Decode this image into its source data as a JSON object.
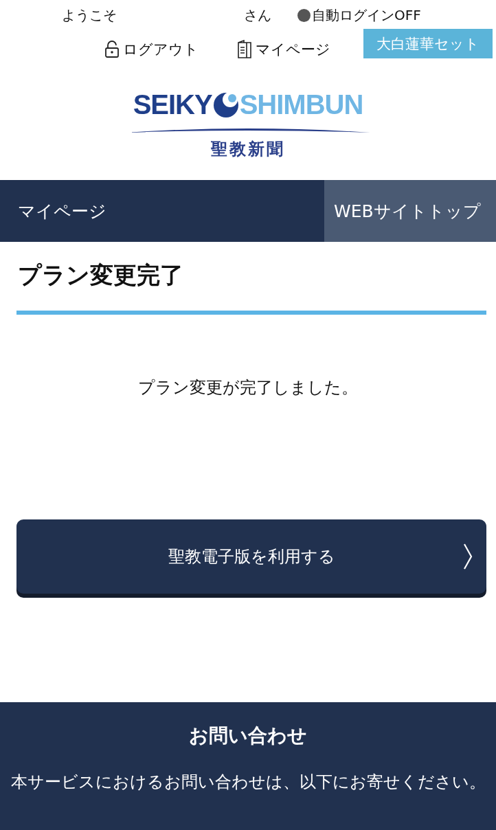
{
  "header": {
    "welcome": "ようこそ",
    "honorific": "さん",
    "auto_login": "自動ログインOFF",
    "links": [
      {
        "kind": "logout",
        "label": "ログアウト"
      },
      {
        "kind": "mypage",
        "label": "マイページ"
      }
    ],
    "badge": "大白蓮華セット"
  },
  "logo": {
    "left": "SEIKY",
    "right": "SHIMBUN",
    "subtitle": "聖教新聞"
  },
  "nav": [
    {
      "label": "マイページ",
      "selected": true
    },
    {
      "label": "WEBサイトトップ",
      "selected": false
    }
  ],
  "page_title": "プラン変更完了",
  "message": "プラン変更が完了しました。",
  "action_button": "聖教電子版を利用する",
  "footer": {
    "title": "お問い合わせ",
    "text": "本サービスにおけるお問い合わせは、以下にお寄せください。"
  }
}
